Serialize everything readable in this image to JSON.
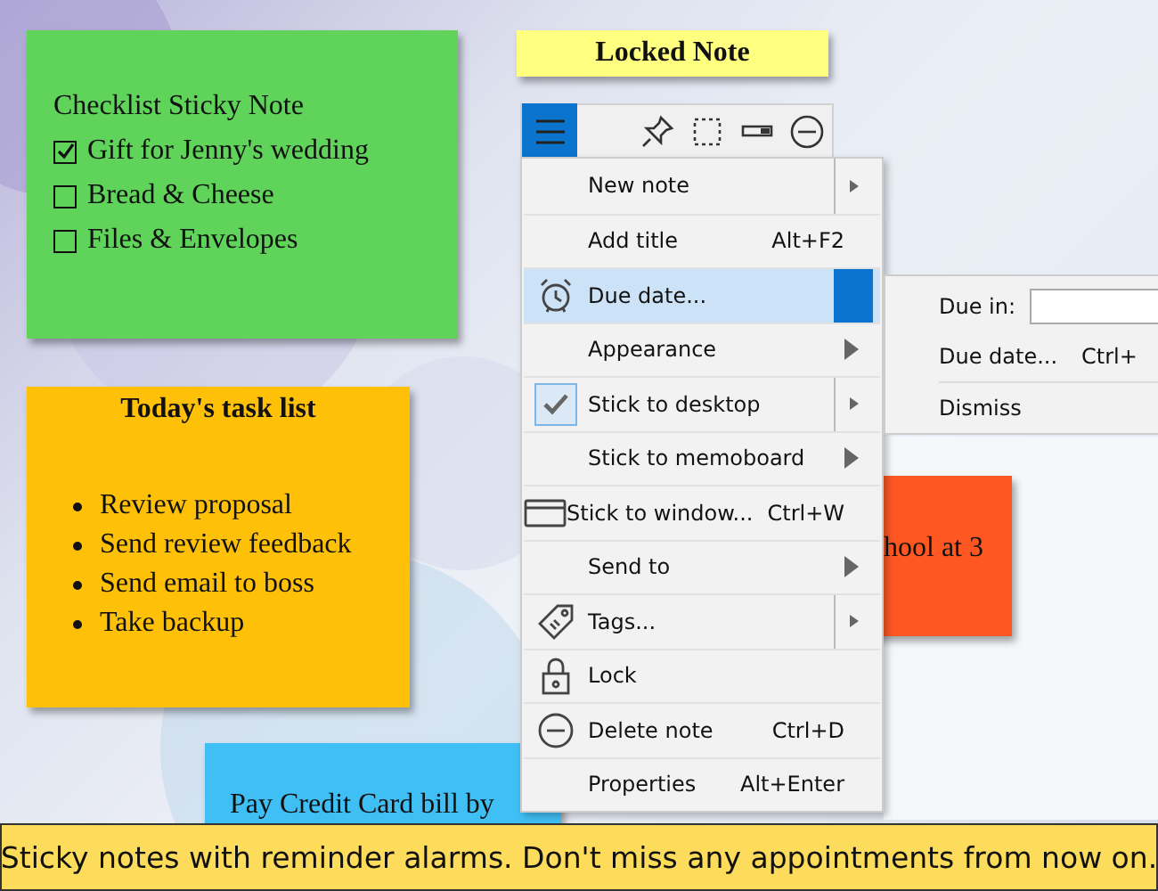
{
  "checklist_note": {
    "title": "Checklist Sticky Note",
    "items": [
      {
        "label": "Gift for Jenny's wedding",
        "checked": true
      },
      {
        "label": "Bread & Cheese",
        "checked": false
      },
      {
        "label": "Files & Envelopes",
        "checked": false
      }
    ]
  },
  "task_note": {
    "title": "Today's task list",
    "items": [
      "Review proposal",
      "Send review feedback",
      "Send email to boss",
      "Take backup"
    ]
  },
  "bill_note": {
    "text": "Pay Credit Card bill by"
  },
  "orange_note": {
    "text": "hool at 3"
  },
  "locked_note": {
    "title": "Locked Note"
  },
  "menu": {
    "items": [
      {
        "label": "New note",
        "kind": "split",
        "selected": false,
        "checked": false
      },
      {
        "label": "Add title",
        "shortcut": "Alt+F2",
        "kind": "plain",
        "selected": false,
        "checked": false
      },
      {
        "label": "Due date...",
        "kind": "split",
        "selected": true,
        "checked": false
      },
      {
        "label": "Appearance",
        "kind": "arrow",
        "selected": false,
        "checked": false
      },
      {
        "label": "Stick to desktop",
        "kind": "split",
        "selected": false,
        "checked": true
      },
      {
        "label": "Stick to memoboard",
        "kind": "arrow",
        "selected": false,
        "checked": false
      },
      {
        "label": "Stick to window...",
        "shortcut": "Ctrl+W",
        "kind": "plain",
        "selected": false,
        "checked": false
      },
      {
        "label": "Send to",
        "kind": "arrow",
        "selected": false,
        "checked": false
      },
      {
        "label": "Tags...",
        "kind": "split",
        "selected": false,
        "checked": false
      },
      {
        "label": "Lock",
        "kind": "plain",
        "selected": false,
        "checked": false
      },
      {
        "label": "Delete note",
        "shortcut": "Ctrl+D",
        "kind": "plain",
        "selected": false,
        "checked": false
      },
      {
        "label": "Properties",
        "shortcut": "Alt+Enter",
        "kind": "plain",
        "selected": false,
        "checked": false
      }
    ]
  },
  "submenu": {
    "due_in_label": "Due in:",
    "items": [
      {
        "label": "Due date...",
        "shortcut": "Ctrl+"
      },
      {
        "label": "Dismiss"
      }
    ]
  },
  "caption": "Sticky notes with reminder alarms. Don't miss any appointments from now on."
}
